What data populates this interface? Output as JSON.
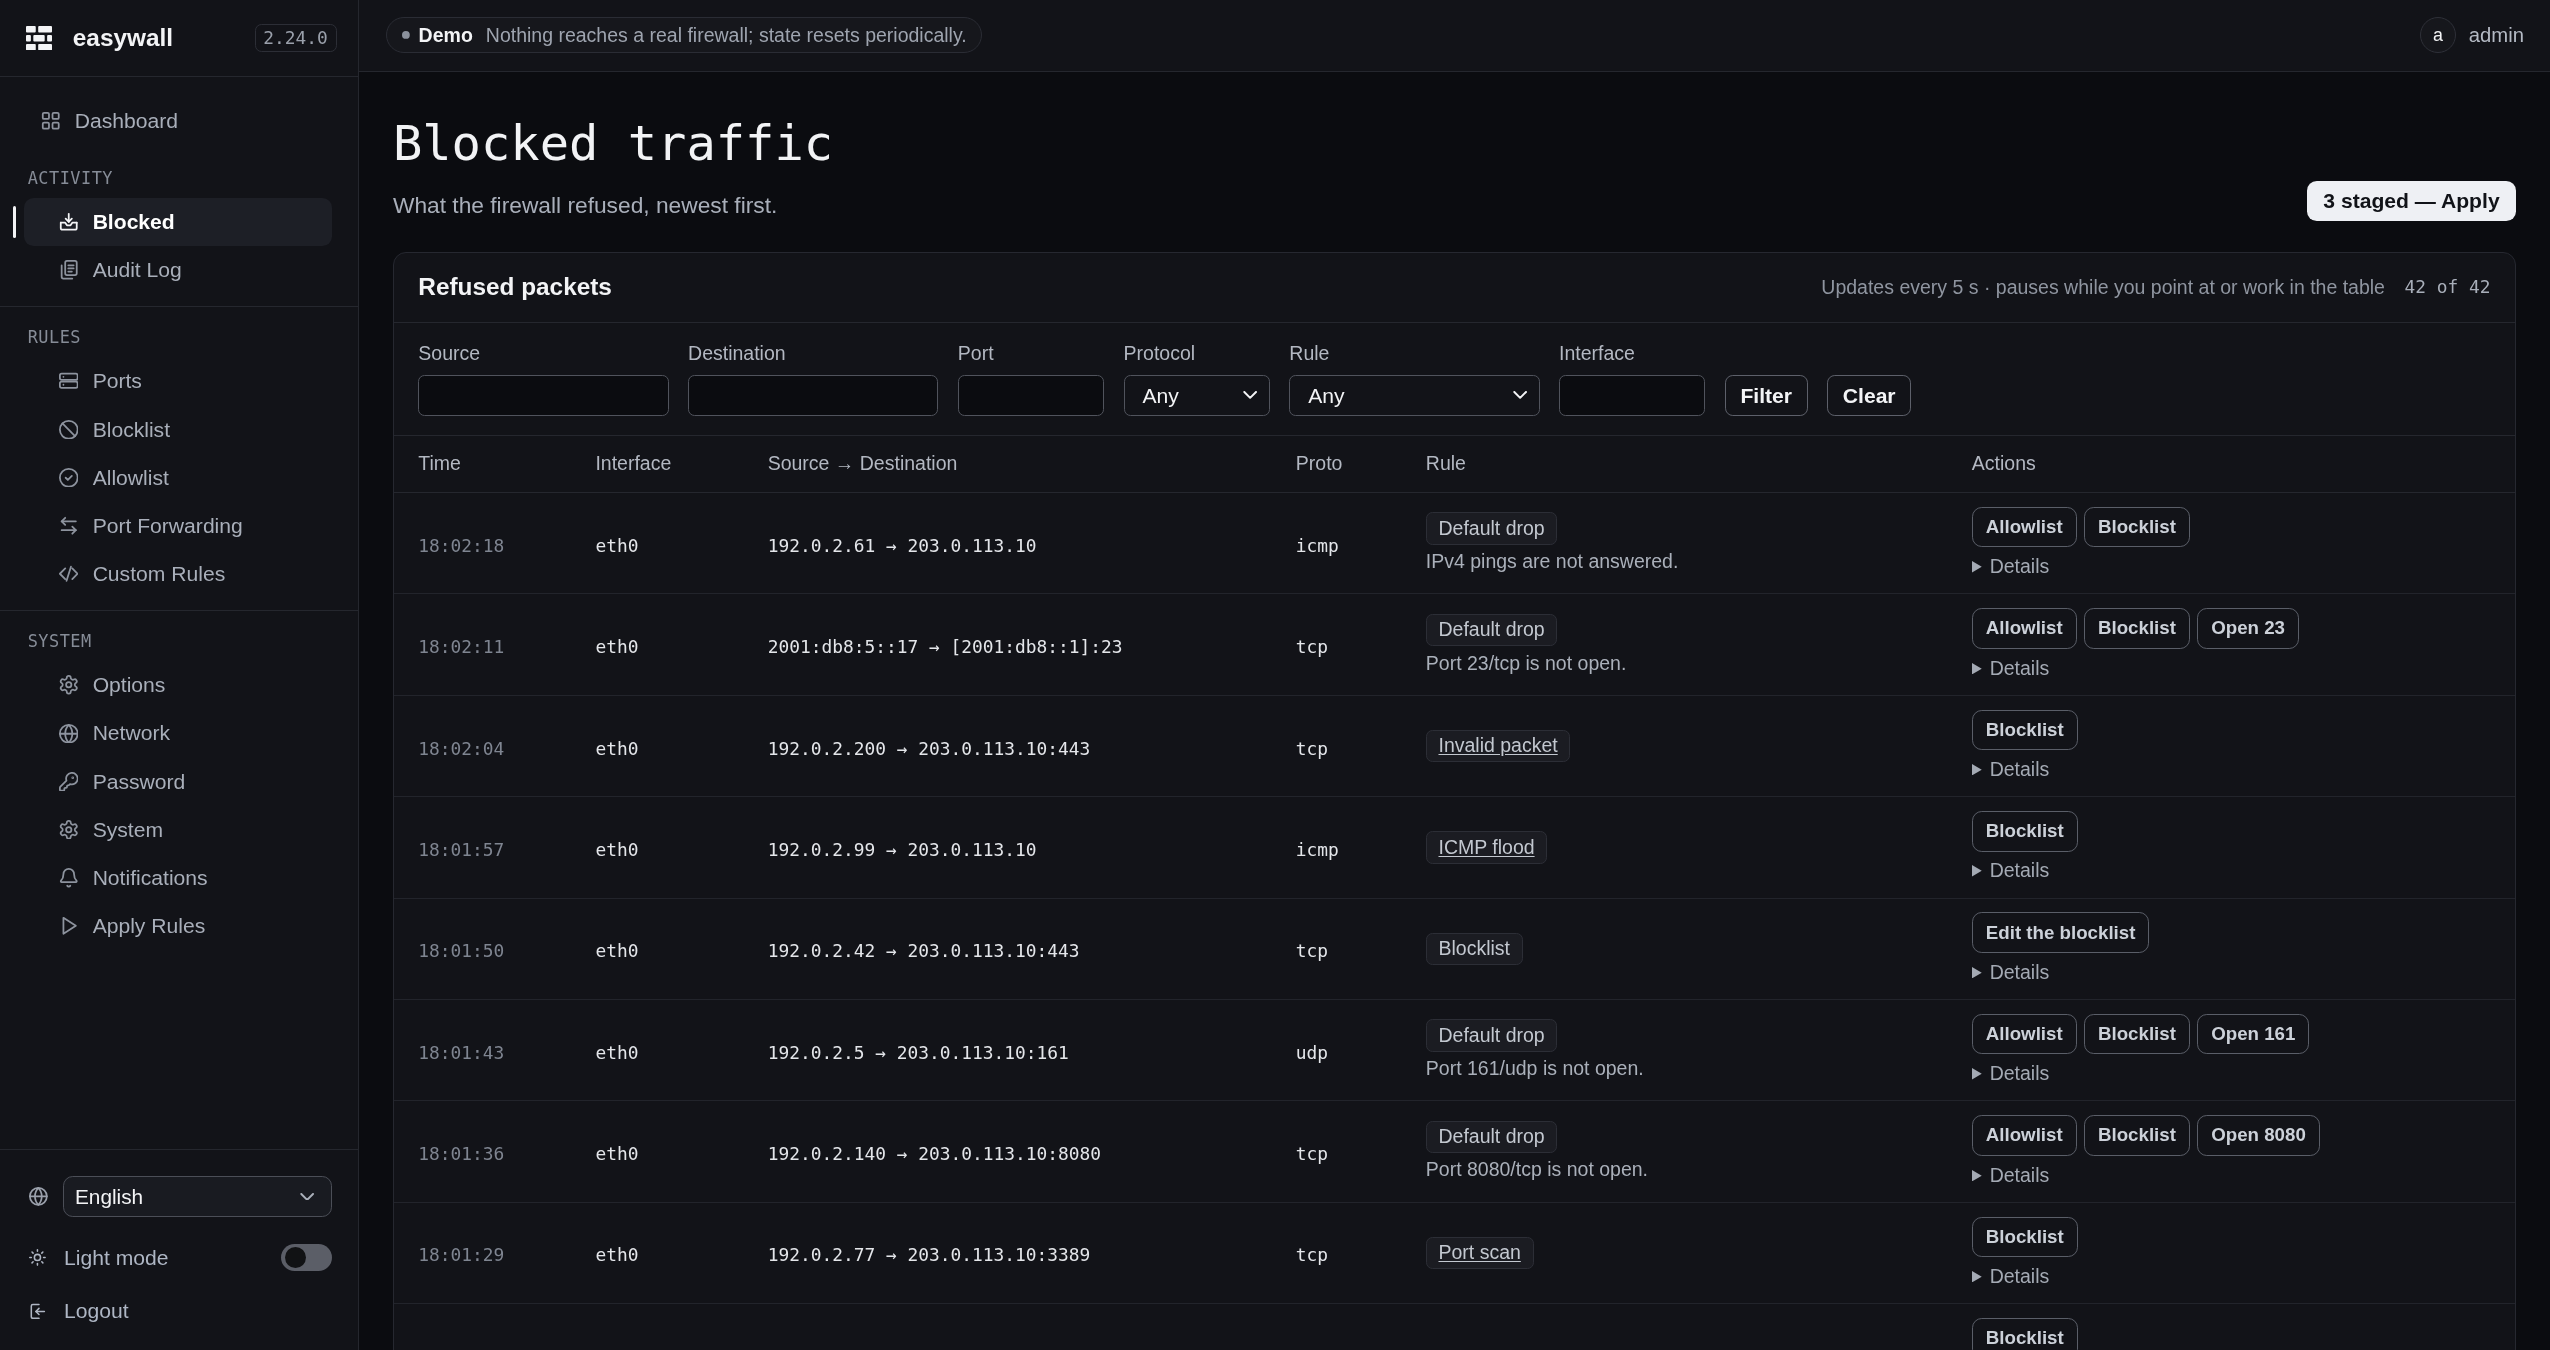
{
  "sidebar": {
    "brand": {
      "name": "easywall",
      "version": "2.24.0"
    },
    "items": [
      {
        "label": "Dashboard",
        "selected": false
      }
    ],
    "sections": [
      {
        "title": "ACTIVITY",
        "items": [
          {
            "label": "Blocked",
            "selected": true
          },
          {
            "label": "Audit Log",
            "selected": false
          }
        ]
      },
      {
        "title": "RULES",
        "items": [
          {
            "label": "Ports",
            "selected": false
          },
          {
            "label": "Blocklist",
            "selected": false
          },
          {
            "label": "Allowlist",
            "selected": false
          },
          {
            "label": "Port Forwarding",
            "selected": false
          },
          {
            "label": "Custom Rules",
            "selected": false
          }
        ]
      },
      {
        "title": "SYSTEM",
        "items": [
          {
            "label": "Options",
            "selected": false
          },
          {
            "label": "Network",
            "selected": false
          },
          {
            "label": "Password",
            "selected": false
          },
          {
            "label": "System",
            "selected": false
          },
          {
            "label": "Notifications",
            "selected": false
          },
          {
            "label": "Apply Rules",
            "selected": false
          }
        ]
      }
    ],
    "language": {
      "value": "English"
    },
    "light_mode": {
      "label": "Light mode",
      "on": false
    },
    "logout": {
      "label": "Logout"
    }
  },
  "topbar": {
    "demo": {
      "label": "Demo",
      "message": "Nothing reaches a real firewall; state resets periodically."
    },
    "user": {
      "avatar": "a",
      "name": "admin"
    }
  },
  "page": {
    "title": "Blocked traffic",
    "subtitle": "What the firewall refused, newest first.",
    "apply_button": "3 staged — Apply"
  },
  "card": {
    "title": "Refused packets",
    "status": "Updates every 5 s · pauses while you point at or work in the table",
    "count": "42 of 42",
    "filters": [
      {
        "label": "Source",
        "kind": "text"
      },
      {
        "label": "Destination",
        "kind": "text"
      },
      {
        "label": "Port",
        "kind": "text"
      },
      {
        "label": "Protocol",
        "kind": "select",
        "value": "Any"
      },
      {
        "label": "Rule",
        "kind": "select",
        "value": "Any"
      },
      {
        "label": "Interface",
        "kind": "text"
      }
    ],
    "buttons": [
      "Filter",
      "Clear"
    ],
    "table": {
      "columns": [
        "Time",
        "Interface",
        "Source → Destination",
        "Proto",
        "Rule",
        "Actions"
      ],
      "rows": [
        {
          "time": "18:02:18",
          "interface": "eth0",
          "route": "192.0.2.61 → 203.0.113.10",
          "proto": "icmp",
          "rule": {
            "label": "Default drop",
            "linked": false
          },
          "note": "IPv4 pings are not answered.",
          "actions": [
            "Allowlist",
            "Blocklist"
          ],
          "details": {
            "label": "Details",
            "expanded": false
          }
        },
        {
          "time": "18:02:11",
          "interface": "eth0",
          "route": "2001:db8:5::17 → [2001:db8::1]:23",
          "proto": "tcp",
          "rule": {
            "label": "Default drop",
            "linked": false
          },
          "note": "Port 23/tcp is not open.",
          "actions": [
            "Allowlist",
            "Blocklist",
            "Open 23"
          ],
          "details": {
            "label": "Details",
            "expanded": false
          }
        },
        {
          "time": "18:02:04",
          "interface": "eth0",
          "route": "192.0.2.200 → 203.0.113.10:443",
          "proto": "tcp",
          "rule": {
            "label": "Invalid packet",
            "linked": true
          },
          "actions": [
            "Blocklist"
          ],
          "details": {
            "label": "Details",
            "expanded": false
          }
        },
        {
          "time": "18:01:57",
          "interface": "eth0",
          "route": "192.0.2.99 → 203.0.113.10",
          "proto": "icmp",
          "rule": {
            "label": "ICMP flood",
            "linked": true
          },
          "actions": [
            "Blocklist"
          ],
          "details": {
            "label": "Details",
            "expanded": false
          }
        },
        {
          "time": "18:01:50",
          "interface": "eth0",
          "route": "192.0.2.42 → 203.0.113.10:443",
          "proto": "tcp",
          "rule": {
            "label": "Blocklist",
            "linked": false
          },
          "actions": [
            "Edit the blocklist"
          ],
          "details": {
            "label": "Details",
            "expanded": false
          }
        },
        {
          "time": "18:01:43",
          "interface": "eth0",
          "route": "192.0.2.5 → 203.0.113.10:161",
          "proto": "udp",
          "rule": {
            "label": "Default drop",
            "linked": false
          },
          "note": "Port 161/udp is not open.",
          "actions": [
            "Allowlist",
            "Blocklist",
            "Open 161"
          ],
          "details": {
            "label": "Details",
            "expanded": false
          }
        },
        {
          "time": "18:01:36",
          "interface": "eth0",
          "route": "192.0.2.140 → 203.0.113.10:8080",
          "proto": "tcp",
          "rule": {
            "label": "Default drop",
            "linked": false
          },
          "note": "Port 8080/tcp is not open.",
          "actions": [
            "Allowlist",
            "Blocklist",
            "Open 8080"
          ],
          "details": {
            "label": "Details",
            "expanded": false
          }
        },
        {
          "time": "18:01:29",
          "interface": "eth0",
          "route": "192.0.2.77 → 203.0.113.10:3389",
          "proto": "tcp",
          "rule": {
            "label": "Port scan",
            "linked": true
          },
          "actions": [
            "Blocklist"
          ],
          "details": {
            "label": "Details",
            "expanded": false
          }
        },
        {
          "actions": [
            "Blocklist"
          ]
        }
      ]
    }
  }
}
